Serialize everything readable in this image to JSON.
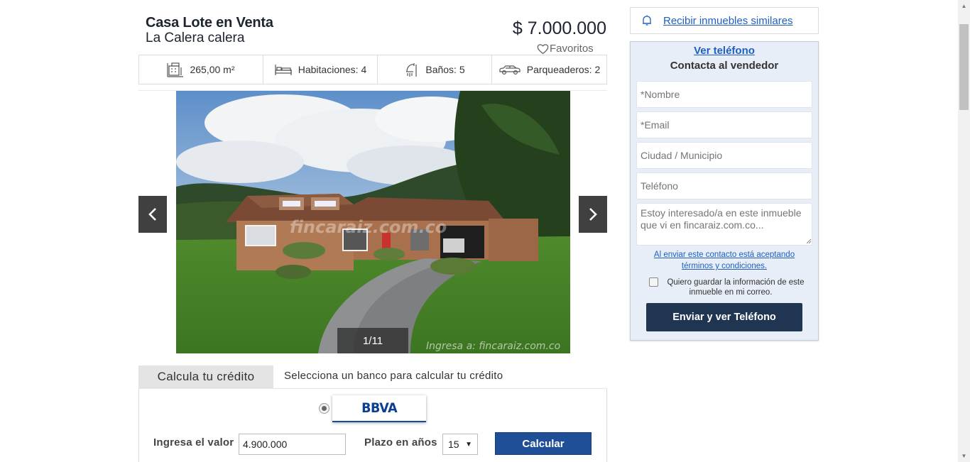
{
  "listing": {
    "title": "Casa Lote en Venta",
    "location": "La Calera calera",
    "price": "$ 7.000.000",
    "favorites_label": "Favoritos"
  },
  "features": [
    {
      "icon": "building-area-icon",
      "label": "265,00 m²"
    },
    {
      "icon": "bed-icon",
      "label": "Habitaciones: 4"
    },
    {
      "icon": "shower-icon",
      "label": "Baños: 5"
    },
    {
      "icon": "car-icon",
      "label": "Parqueaderos: 2"
    }
  ],
  "gallery": {
    "counter": "1/11",
    "watermark_center": "fincaraiz.com.co",
    "watermark_corner": "Ingresa a: fincaraiz.com.co"
  },
  "credit": {
    "tab_label": "Calcula tu crédito",
    "caption": "Selecciona un banco para calcular tu crédito",
    "bank_name": "BBVA",
    "value_label": "Ingresa el valor",
    "value": "4.900.000",
    "term_label": "Plazo en años",
    "term_value": "15",
    "calculate_label": "Calcular"
  },
  "sidebar": {
    "similar_label": "Recibir inmuebles similares",
    "ver_telefono": "Ver teléfono",
    "contact_heading": "Contacta al vendedor",
    "name_placeholder": "*Nombre",
    "email_placeholder": "*Email",
    "city_placeholder": "Ciudad / Municipio",
    "phone_placeholder": "Teléfono",
    "message_placeholder": "Estoy interesado/a en este inmueble que vi en fincaraiz.com.co...",
    "terms_line1": "Al enviar este contacto está aceptando",
    "terms_line2": "términos y condiciones.",
    "save_info": "Quiero guardar la información de este inmueble en mi correo.",
    "send_label": "Enviar y ver Teléfono"
  },
  "colors": {
    "primary_blue": "#1e4f97",
    "dark_navy": "#1f3552",
    "link_blue": "#1f5fbf",
    "contact_bg": "#e8eef7"
  }
}
